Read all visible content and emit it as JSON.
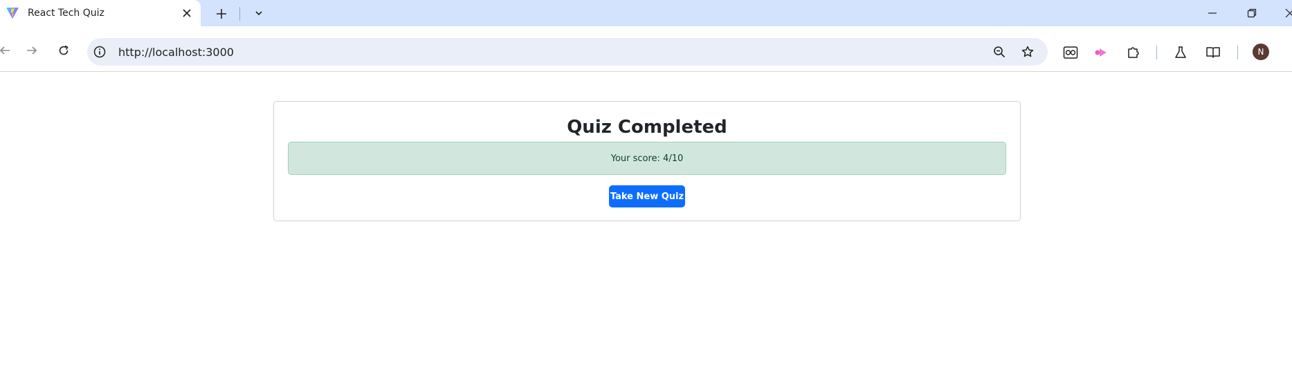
{
  "browser": {
    "tab": {
      "title": "React Tech Quiz"
    },
    "address_bar": {
      "url": "http://localhost:3000"
    },
    "profile": {
      "initial": "N"
    }
  },
  "quiz": {
    "title": "Quiz Completed",
    "score_text": "Your score: 4/10",
    "new_quiz_label": "Take New Quiz"
  },
  "colors": {
    "tabstrip_bg": "#d3e3fd",
    "omnibox_bg": "#e9eef8",
    "alert_success_bg": "#d1e7dd",
    "primary_button": "#0d6efd"
  }
}
